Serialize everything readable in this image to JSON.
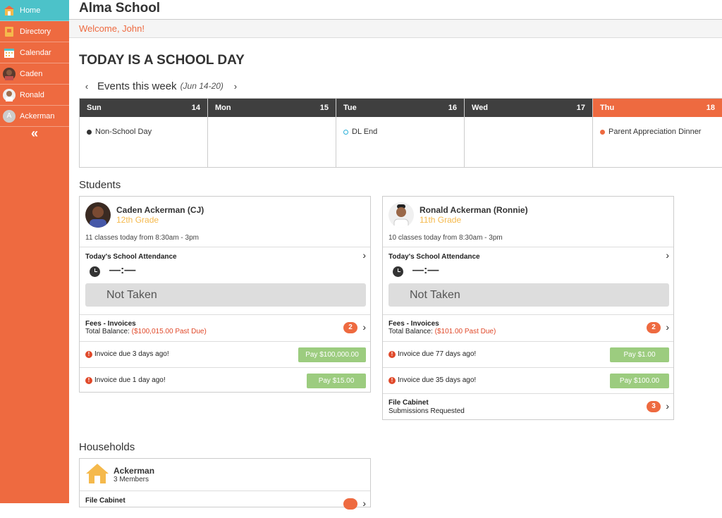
{
  "sidebar": {
    "items": [
      {
        "label": "Home",
        "icon": "school-icon",
        "active": true
      },
      {
        "label": "Directory",
        "icon": "book-icon"
      },
      {
        "label": "Calendar",
        "icon": "calendar-icon"
      },
      {
        "label": "Caden",
        "icon": "avatar"
      },
      {
        "label": "Ronald",
        "icon": "avatar"
      },
      {
        "label": "Ackerman",
        "icon": "avatar-letter",
        "letter": "A"
      }
    ],
    "collapse_label": "«"
  },
  "header": {
    "title": "Alma School",
    "welcome": "Welcome, John!"
  },
  "today_heading": "TODAY IS A SCHOOL DAY",
  "week": {
    "label": "Events this week",
    "range": "(Jun 14-20)",
    "prev": "‹",
    "next": "›",
    "days": [
      {
        "name": "Sun",
        "date": "14",
        "event": "Non-School Day",
        "dot_color": "#333333"
      },
      {
        "name": "Mon",
        "date": "15",
        "event": "",
        "dot_color": ""
      },
      {
        "name": "Tue",
        "date": "16",
        "event": "DL End",
        "dot_color": "#2ab0d9"
      },
      {
        "name": "Wed",
        "date": "17",
        "event": "",
        "dot_color": ""
      },
      {
        "name": "Thu",
        "date": "18",
        "event": "Parent Appreciation Dinner",
        "dot_color": "#ee6a40",
        "today": true
      }
    ]
  },
  "students_title": "Students",
  "students": [
    {
      "name": "Caden Ackerman (CJ)",
      "grade": "12th Grade",
      "classes": "11 classes today from 8:30am - 3pm",
      "attendance_title": "Today's School Attendance",
      "time": "—:—",
      "status": "Not Taken",
      "fees_title": "Fees - Invoices",
      "balance_label": "Total Balance:",
      "balance_value": "($100,015.00 Past Due)",
      "fees_count": "2",
      "invoices": [
        {
          "text": "Invoice due 3 days ago!",
          "pay": "Pay $100,000.00"
        },
        {
          "text": "Invoice due 1 day ago!",
          "pay": "Pay $15.00"
        }
      ]
    },
    {
      "name": "Ronald Ackerman (Ronnie)",
      "grade": "11th Grade",
      "classes": "10 classes today from 8:30am - 3pm",
      "attendance_title": "Today's School Attendance",
      "time": "—:—",
      "status": "Not Taken",
      "fees_title": "Fees - Invoices",
      "balance_label": "Total Balance:",
      "balance_value": "($101.00 Past Due)",
      "fees_count": "2",
      "invoices": [
        {
          "text": "Invoice due 77 days ago!",
          "pay": "Pay $1.00"
        },
        {
          "text": "Invoice due 35 days ago!",
          "pay": "Pay $100.00"
        }
      ],
      "file_cabinet": {
        "title": "File Cabinet",
        "sub": "Submissions Requested",
        "count": "3"
      }
    }
  ],
  "households_title": "Households",
  "household": {
    "name": "Ackerman",
    "members": "3 Members",
    "file_cabinet": "File Cabinet"
  },
  "colors": {
    "accent": "#ee6a40",
    "active_nav": "#4cc2c9",
    "grade": "#f5b94c",
    "pay_button": "#9ccc7f",
    "past_due": "#e0492a"
  }
}
